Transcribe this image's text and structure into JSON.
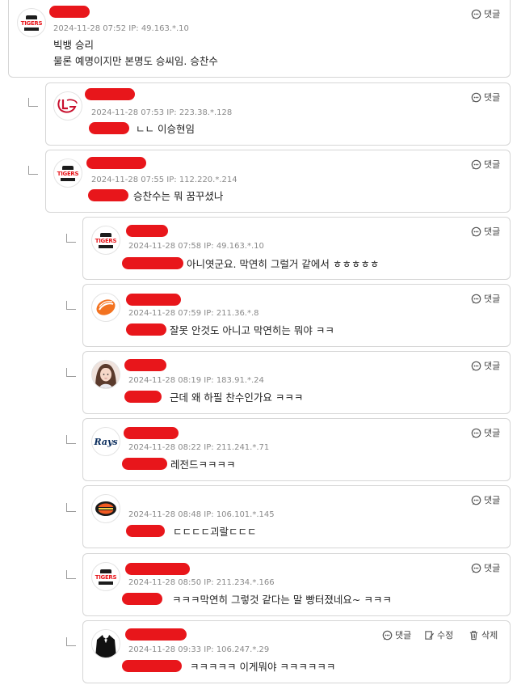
{
  "reply_label": "댓글",
  "edit_label": "수정",
  "delete_label": "삭제",
  "comments": [
    {
      "meta": "2024-11-28 07:52 IP: 49.163.*.10",
      "line1": "빅뱅 승리",
      "line2": "물론 예명이지만 본명도 승씨임. 승찬수",
      "avatar": "tigers-logo"
    },
    {
      "meta": "2024-11-28 07:53 IP: 223.38.*.128",
      "text": "ㄴㄴ 이승현임",
      "avatar": "lg-twins-logo"
    },
    {
      "meta": "2024-11-28 07:55 IP: 112.220.*.214",
      "text": "승찬수는 뭐 꿈꾸셨나",
      "avatar": "tigers-logo"
    },
    {
      "meta": "2024-11-28 07:58 IP: 49.163.*.10",
      "text": "아니엿군요. 막연히 그럴거 같에서 ㅎㅎㅎㅎㅎ",
      "avatar": "tigers-logo"
    },
    {
      "meta": "2024-11-28 07:59 IP: 211.36.*.8",
      "text": "잘못 안것도 아니고 막연히는 뭐야 ㅋㅋ",
      "avatar": "eagles-logo"
    },
    {
      "meta": "2024-11-28 08:19 IP: 183.91.*.24",
      "text": "근데 왜 하필 찬수인가요 ㅋㅋㅋ",
      "avatar": "user-photo"
    },
    {
      "meta": "2024-11-28 08:22 IP: 211.241.*.71",
      "text": "레전드ㅋㅋㅋㅋ",
      "avatar": "rays-logo",
      "logo_text": "Rays"
    },
    {
      "meta": "2024-11-28 08:48 IP: 106.101.*.145",
      "text": "ㄷㄷㄷㄷ괴랄ㄷㄷㄷ",
      "avatar": "giants-logo"
    },
    {
      "meta": "2024-11-28 08:50 IP: 211.234.*.166",
      "text": "ㅋㅋㅋ막연히 그렇것 같다는 말 빵터졌네요~ ㅋㅋㅋ",
      "avatar": "tigers-logo"
    },
    {
      "meta": "2024-11-28 09:33 IP: 106.247.*.29",
      "text": "ㅋㅋㅋㅋㅋ 이게뭐야 ㅋㅋㅋㅋㅋㅋ",
      "avatar": "tuxedo-avatar"
    }
  ],
  "logo_text": {
    "tigers": "TIGERS"
  }
}
